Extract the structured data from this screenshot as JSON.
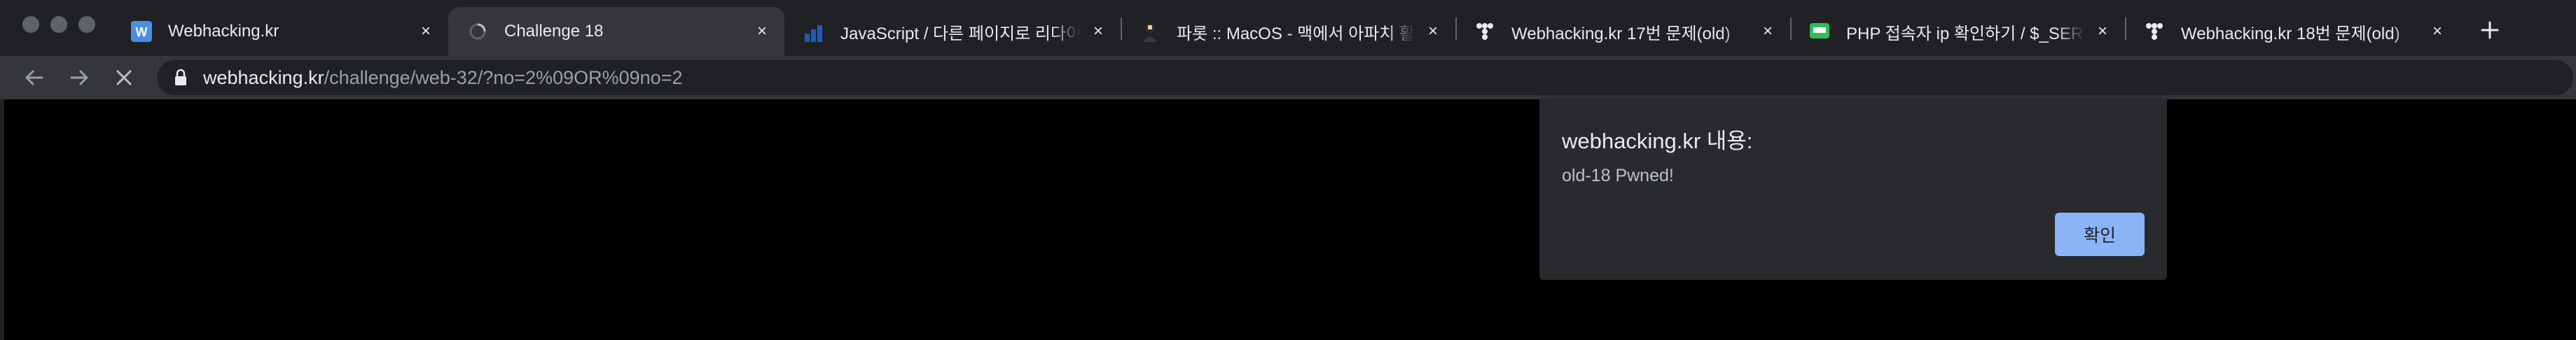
{
  "tabs": [
    {
      "title": "Webhacking.kr",
      "favicon": "webhacking-w-icon",
      "close_label": "×"
    },
    {
      "title": "Challenge 18",
      "favicon": "loading-spinner-icon",
      "close_label": "×"
    },
    {
      "title": "JavaScript / 다른 페이지로 리다이렉트",
      "favicon": "bar-chart-favicon",
      "close_label": "×"
    },
    {
      "title": "파롯 :: MacOS - 맥에서 아파치 활성화",
      "favicon": "avatar-favicon",
      "close_label": "×"
    },
    {
      "title": "Webhacking.kr 17번 문제(old)",
      "favicon": "dots-favicon",
      "close_label": "×"
    },
    {
      "title": "PHP 접속자 ip 확인하기 / $_SERVER",
      "favicon": "green-chat-favicon",
      "close_label": "×"
    },
    {
      "title": "Webhacking.kr 18번 문제(old)",
      "favicon": "dots-favicon",
      "close_label": "×"
    }
  ],
  "new_tab_label": "+",
  "address_bar": {
    "host": "webhacking.kr",
    "path": "/challenge/web-32/?no=2%09OR%09no=2"
  },
  "dialog": {
    "title": "webhacking.kr 내용:",
    "message": "old-18 Pwned!",
    "ok_label": "확인"
  },
  "colors": {
    "tabstrip_bg": "#202124",
    "active_tab_bg": "#35363a",
    "dialog_bg": "#292a2d",
    "ok_button": "#8ab4f8"
  }
}
